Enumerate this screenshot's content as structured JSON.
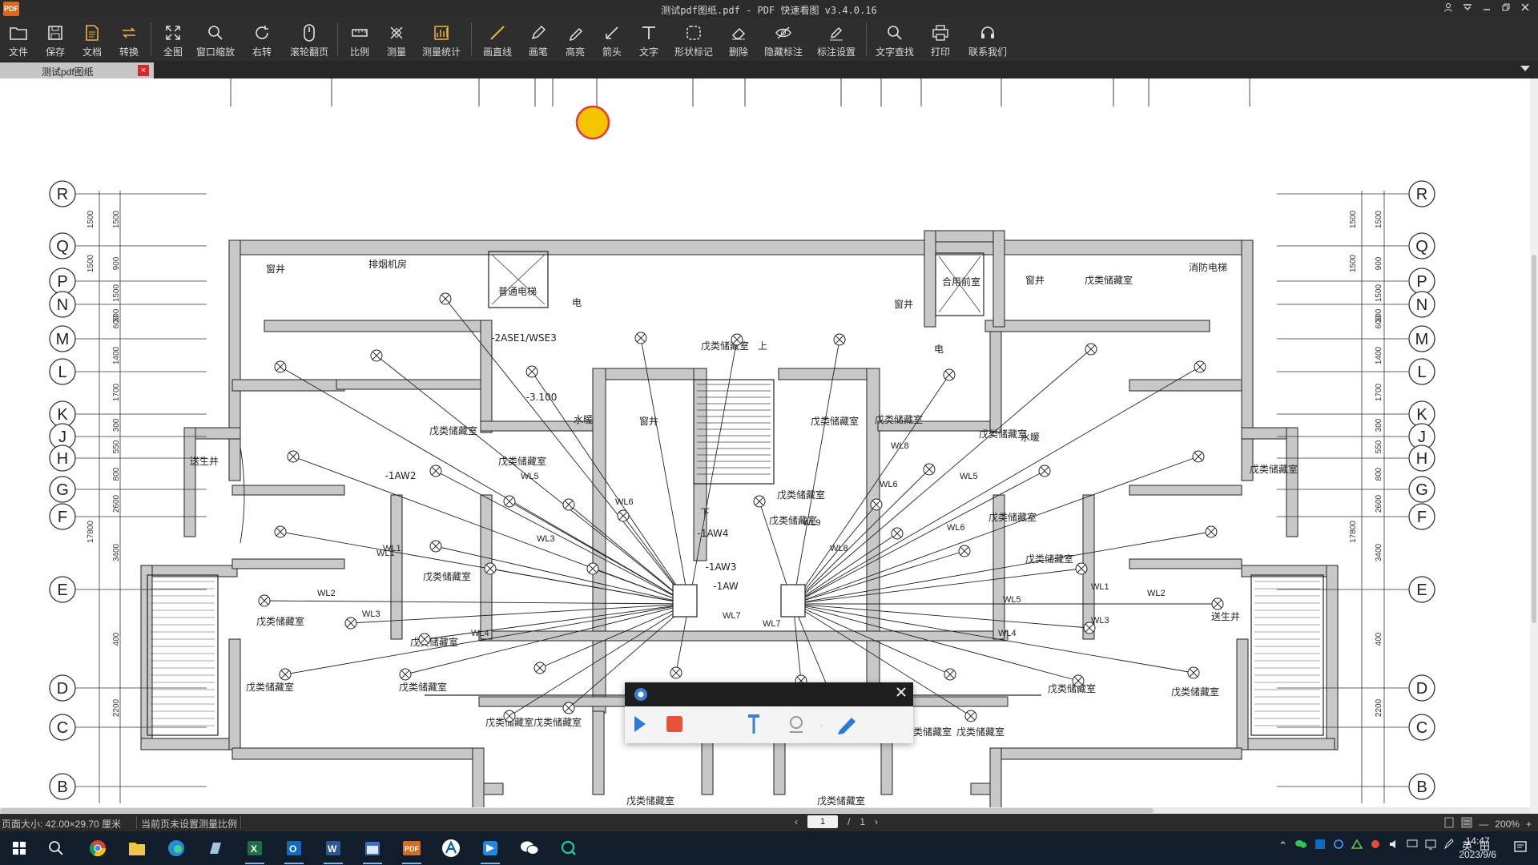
{
  "window": {
    "title": "测试pdf图纸.pdf - PDF 快速看图 v3.4.0.16",
    "logo": "PDF",
    "controls": [
      "user-icon",
      "dropdown-icon",
      "minimize-icon",
      "restore-icon",
      "close-icon"
    ]
  },
  "toolbar": {
    "buttons": [
      {
        "id": "file",
        "label": "文件",
        "icon": "folder-icon"
      },
      {
        "id": "save",
        "label": "保存",
        "icon": "save-icon"
      },
      {
        "id": "doc",
        "label": "文档",
        "icon": "document-icon"
      },
      {
        "id": "convert",
        "label": "转换",
        "icon": "convert-icon"
      },
      {
        "id": "fit",
        "label": "全图",
        "icon": "fullscreen-icon"
      },
      {
        "id": "window-zoom",
        "label": "窗口缩放",
        "icon": "magnifier-icon"
      },
      {
        "id": "rotate",
        "label": "右转",
        "icon": "rotate-icon"
      },
      {
        "id": "scroll-page",
        "label": "滚轮翻页",
        "icon": "mouse-icon"
      },
      {
        "id": "scale",
        "label": "比例",
        "icon": "ruler-icon"
      },
      {
        "id": "measure",
        "label": "测量",
        "icon": "measure-icon"
      },
      {
        "id": "measure-stats",
        "label": "测量统计",
        "icon": "stats-icon"
      },
      {
        "id": "line",
        "label": "画直线",
        "icon": "line-icon"
      },
      {
        "id": "pen",
        "label": "画笔",
        "icon": "pen-icon"
      },
      {
        "id": "highlight",
        "label": "高亮",
        "icon": "highlighter-icon"
      },
      {
        "id": "arrow",
        "label": "箭头",
        "icon": "arrow-icon"
      },
      {
        "id": "text",
        "label": "文字",
        "icon": "text-icon"
      },
      {
        "id": "shape-mark",
        "label": "形状标记",
        "icon": "shape-icon"
      },
      {
        "id": "delete",
        "label": "删除",
        "icon": "eraser-icon"
      },
      {
        "id": "hide-mark",
        "label": "隐藏标注",
        "icon": "eye-hide-icon"
      },
      {
        "id": "mark-settings",
        "label": "标注设置",
        "icon": "settings-pen-icon"
      },
      {
        "id": "text-search",
        "label": "文字查找",
        "icon": "search-icon"
      },
      {
        "id": "print",
        "label": "打印",
        "icon": "printer-icon"
      },
      {
        "id": "contact",
        "label": "联系我们",
        "icon": "headset-icon"
      }
    ]
  },
  "tabs": [
    {
      "label": "测试pdf图纸",
      "close": "×"
    }
  ],
  "drawing": {
    "grid_left": [
      "R",
      "Q",
      "P",
      "N",
      "M",
      "L",
      "K",
      "J",
      "H",
      "G",
      "F",
      "E",
      "D",
      "C",
      "B"
    ],
    "grid_right": [
      "R",
      "Q",
      "P",
      "N",
      "M",
      "L",
      "K",
      "J",
      "H",
      "G",
      "F",
      "E",
      "D",
      "C",
      "B"
    ],
    "dims_left_outer": [
      "1500",
      "1500",
      "17800"
    ],
    "dims_left_inner": [
      "1500",
      "900",
      "1500",
      "300",
      "600",
      "1400",
      "1700",
      "300",
      "550",
      "800",
      "2600",
      "3400",
      "400",
      "2200"
    ],
    "dims_right_inner": [
      "1500",
      "900",
      "1500",
      "300",
      "600",
      "1400",
      "1700",
      "300",
      "550",
      "800",
      "2600",
      "3400",
      "400",
      "2200"
    ],
    "dims_right_outer": [
      "1500",
      "1500",
      "17800"
    ],
    "rooms": [
      "窗井",
      "排烟机房",
      "普通电梯",
      "电",
      "-2ASE1/WSE3",
      "-3.100",
      "水暖",
      "窗井",
      "戊类储藏室",
      "戊类储藏室",
      "送生井",
      "戊类储藏室",
      "戊类储藏室",
      "戊类储藏室",
      "戊类储藏室",
      "戊类储藏室",
      "戊类储藏室",
      "戊类储藏室",
      "戊类储藏室",
      "戊类储藏室",
      "窗井",
      "电",
      "合用前室",
      "消防电梯",
      "窗井",
      "戊类储藏室",
      "戊类储藏室",
      "水暖",
      "戊类储藏室",
      "戊类储藏室",
      "戊类储藏室",
      "送生井",
      "戊类储藏室",
      "戊类储藏室",
      "戊类储藏室",
      "戊类储藏室",
      "戊类储藏室",
      "戊类储藏室",
      "戊类储藏室",
      "戊类储藏室",
      "戊类储藏室",
      "上",
      "下",
      "-1AW4",
      "-1AW3",
      "-1AW",
      "-1AW2"
    ],
    "circuits": [
      "WL1",
      "WL2",
      "WL3",
      "WL4",
      "WL5",
      "WL6",
      "WL7",
      "WL8",
      "WL9",
      "WL1",
      "WL2",
      "WL3",
      "WL4",
      "WL5",
      "WL6",
      "WL7",
      "WL8",
      "WL1",
      "WL3",
      "WL5",
      "WL6"
    ]
  },
  "status": {
    "page_size": "页面大小: 42.00×29.70 厘米",
    "scale_note": "当前页未设置测量比例",
    "page_current": "1",
    "page_sep": "/",
    "page_total": "1",
    "zoom": "200%",
    "zoom_minus": "—",
    "zoom_plus": "+"
  },
  "taskbar": {
    "apps": [
      "windows-start-icon",
      "search-icon",
      "chrome-icon",
      "file-explorer-icon",
      "edge-icon",
      "notepad-icon",
      "excel-icon",
      "outlook-icon",
      "word-icon",
      "calendar-icon",
      "pdf-viewer-icon",
      "autocad-icon",
      "app-icon",
      "wechat-icon",
      "qq-icon"
    ],
    "tray": [
      "chevron-up-icon",
      "wechat-tray-icon",
      "outlook-tray-icon",
      "network-tray-icon",
      "nvidia-icon",
      "qq-tray-icon",
      "volume-icon",
      "display-icon",
      "monitor-icon",
      "pen-icon"
    ],
    "ime": "英",
    "ime_grid": "田",
    "time": "14:47",
    "date": "2023/9/6"
  },
  "colors": {
    "accent": "#d7282d",
    "pointer": "#f5c400",
    "toolbar_bg": "#2e2e2e",
    "canvas_bg": "#ffffff"
  }
}
